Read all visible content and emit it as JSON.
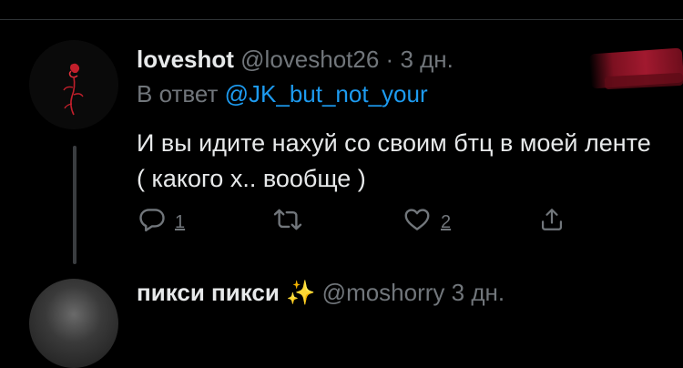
{
  "tweet": {
    "display_name": "loveshot",
    "handle": "@loveshot26",
    "separator": "·",
    "time": "3 дн.",
    "reply_prefix": "В ответ",
    "reply_mention": "@JK_but_not_your",
    "text": "И вы идите нахуй со своим бтц в моей ленте ( какого х.. вообще )",
    "actions": {
      "reply_icon": "reply-icon",
      "reply_count": "1",
      "retweet_icon": "retweet-icon",
      "like_icon": "heart-icon",
      "like_count": "2",
      "share_icon": "share-icon"
    }
  },
  "next_tweet": {
    "display_name": "пикси пикси",
    "emoji": "✨",
    "handle": "@moshorry",
    "time": "3 дн."
  },
  "colors": {
    "background": "#000000",
    "text": "#e7e9ea",
    "muted": "#71767b",
    "link": "#1d9bf0",
    "redaction": "#b31c34"
  }
}
